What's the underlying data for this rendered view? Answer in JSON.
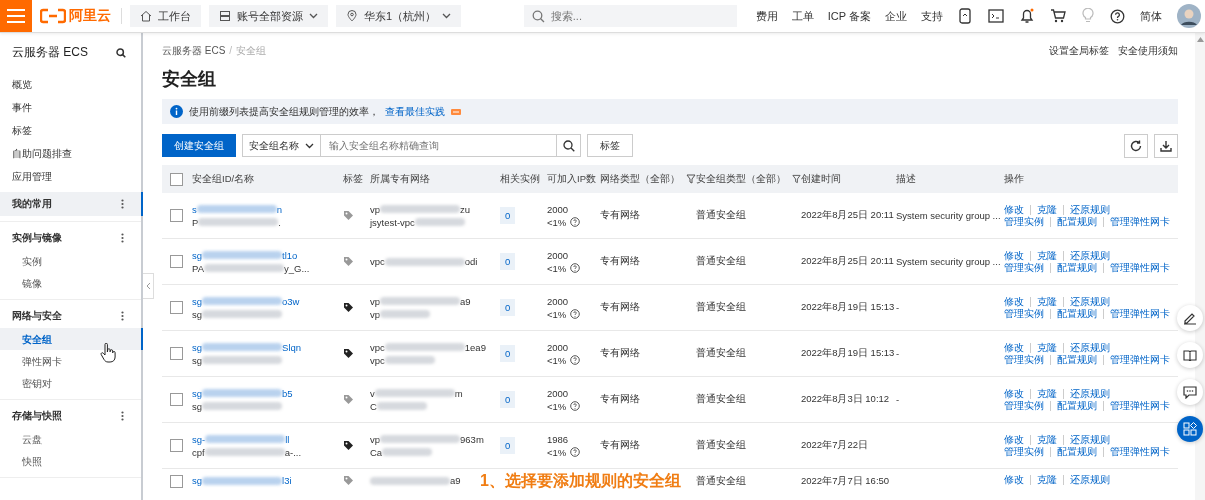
{
  "topbar": {
    "logo": "阿里云",
    "nav": [
      {
        "kind": "home",
        "label": "工作台"
      },
      {
        "kind": "resources",
        "label": "账号全部资源"
      },
      {
        "kind": "region",
        "label": "华东1（杭州）"
      }
    ],
    "search": {
      "placeholder": "搜索..."
    },
    "links": [
      "费用",
      "工单",
      "ICP 备案",
      "企业",
      "支持"
    ],
    "language": "简体"
  },
  "sidebar": {
    "title": "云服务器 ECS",
    "items": [
      "概览",
      "事件",
      "标签",
      "自助问题排查",
      "应用管理"
    ],
    "groups": [
      {
        "label": "我的常用",
        "active": true
      },
      {
        "label": "实例与镜像",
        "active": false,
        "items": [
          {
            "label": "实例",
            "selected": false
          },
          {
            "label": "镜像",
            "selected": false
          }
        ]
      },
      {
        "label": "网络与安全",
        "active": false,
        "items": [
          {
            "label": "安全组",
            "selected": true
          },
          {
            "label": "弹性网卡",
            "selected": false
          },
          {
            "label": "密钥对",
            "selected": false
          }
        ]
      },
      {
        "label": "存储与快照",
        "active": false,
        "items": [
          {
            "label": "云盘",
            "selected": false
          },
          {
            "label": "快照",
            "selected": false
          }
        ]
      }
    ]
  },
  "breadcrumb": [
    "云服务器 ECS",
    "/",
    "安全组"
  ],
  "header_links": [
    "设置全局标签",
    "安全使用须知"
  ],
  "page_title": "安全组",
  "notice": {
    "text": "使用前缀列表提高安全组规则管理的效率，",
    "link": "查看最佳实践"
  },
  "toolbar": {
    "create_button": "创建安全组",
    "filter": "安全组名称",
    "search_placeholder": "输入安全组名称精确查询",
    "tag_button": "标签"
  },
  "table": {
    "all_checked": false,
    "columns": [
      {
        "label": "安全组ID/名称",
        "filter": false
      },
      {
        "label": "标签",
        "filter": false
      },
      {
        "label": "所属专有网络",
        "filter": false
      },
      {
        "label": "相关实例",
        "filter": false
      },
      {
        "label": "可加入IP数",
        "filter": false
      },
      {
        "label": "网络类型（全部）",
        "filter": true
      },
      {
        "label": "安全组类型（全部）",
        "filter": true
      },
      {
        "label": "创建时间",
        "filter": false
      },
      {
        "label": "描述",
        "filter": false
      },
      {
        "label": "操作",
        "filter": false
      }
    ],
    "rows": [
      {
        "checked": false,
        "id": {
          "start": "s",
          "end": "n"
        },
        "name": {
          "start": "P",
          "end": "."
        },
        "tagged": false,
        "vpc": [
          {
            "start": "vp",
            "end": "zu"
          },
          {
            "start": "jsytest-vpc"
          }
        ],
        "instances": "0",
        "ip": "2000",
        "ip_usage": "<1%",
        "network": "专有网络",
        "type": "普通安全组",
        "created": "2022年8月25日 20:11",
        "description": "System security group ...",
        "actions": [
          [
            "修改",
            "克隆",
            "还原规则"
          ],
          [
            "管理实例",
            "配置规则",
            "管理弹性网卡"
          ]
        ]
      },
      {
        "checked": false,
        "id": {
          "start": "sg",
          "end": "tl1o"
        },
        "name": {
          "start": "PA",
          "end": "y_G..."
        },
        "tagged": false,
        "vpc": [
          {
            "start": "vpc",
            "end": "odi"
          }
        ],
        "instances": "0",
        "ip": "2000",
        "ip_usage": "<1%",
        "network": "专有网络",
        "type": "普通安全组",
        "created": "2022年8月25日 20:11",
        "description": "System security group ...",
        "actions": [
          [
            "修改",
            "克隆",
            "还原规则"
          ],
          [
            "管理实例",
            "配置规则",
            "管理弹性网卡"
          ]
        ]
      },
      {
        "checked": false,
        "id": {
          "start": "sg",
          "end": "o3w"
        },
        "name": {
          "start": "sg"
        },
        "tagged": true,
        "vpc": [
          {
            "start": "vp",
            "end": "a9"
          },
          {
            "start": "vp"
          }
        ],
        "instances": "0",
        "ip": "2000",
        "ip_usage": "<1%",
        "network": "专有网络",
        "type": "普通安全组",
        "created": "2022年8月19日 15:13",
        "description": "-",
        "actions": [
          [
            "修改",
            "克隆",
            "还原规则"
          ],
          [
            "管理实例",
            "配置规则",
            "管理弹性网卡"
          ]
        ]
      },
      {
        "checked": false,
        "id": {
          "start": "sg",
          "end": "Slqn"
        },
        "name": {
          "start": "sg"
        },
        "tagged": true,
        "vpc": [
          {
            "start": "vpc",
            "end": "1ea9"
          },
          {
            "start": "vpc"
          }
        ],
        "instances": "0",
        "ip": "2000",
        "ip_usage": "<1%",
        "network": "专有网络",
        "type": "普通安全组",
        "created": "2022年8月19日 15:13",
        "description": "-",
        "actions": [
          [
            "修改",
            "克隆",
            "还原规则"
          ],
          [
            "管理实例",
            "配置规则",
            "管理弹性网卡"
          ]
        ]
      },
      {
        "checked": false,
        "id": {
          "start": "sg",
          "end": "b5"
        },
        "name": {
          "start": "sg"
        },
        "tagged": false,
        "vpc": [
          {
            "start": "v",
            "end": "m"
          },
          {
            "start": "C"
          }
        ],
        "instances": "0",
        "ip": "2000",
        "ip_usage": "<1%",
        "network": "专有网络",
        "type": "普通安全组",
        "created": "2022年8月3日 10:12",
        "description": "-",
        "actions": [
          [
            "修改",
            "克隆",
            "还原规则"
          ],
          [
            "管理实例",
            "配置规则",
            "管理弹性网卡"
          ]
        ]
      },
      {
        "checked": false,
        "id": {
          "start": "sg-",
          "end": "ll"
        },
        "name": {
          "start": "cpf",
          "end": "a-..."
        },
        "tagged": true,
        "vpc": [
          {
            "start": "vp",
            "end": "963m"
          },
          {
            "start": "Ca"
          }
        ],
        "instances": "0",
        "ip": "1986",
        "ip_usage": "<1%",
        "network": "专有网络",
        "type": "普通安全组",
        "created": "2022年7月22日",
        "actions": [
          [
            "修改",
            "克隆",
            "还原规则"
          ],
          [
            "管理实例",
            "配置规则",
            "管理弹性网卡"
          ]
        ]
      },
      {
        "checked": false,
        "id": {
          "start": "sg",
          "end": "l3i"
        },
        "tagged": false,
        "vpc": [
          {
            "end": "a9"
          }
        ],
        "type": "普通安全组",
        "created": "2022年7月7日 16:50",
        "actions": [
          [
            "修改",
            "克隆",
            "还原规则"
          ]
        ]
      }
    ]
  },
  "caption": "1、选择要添加规则的安全组"
}
